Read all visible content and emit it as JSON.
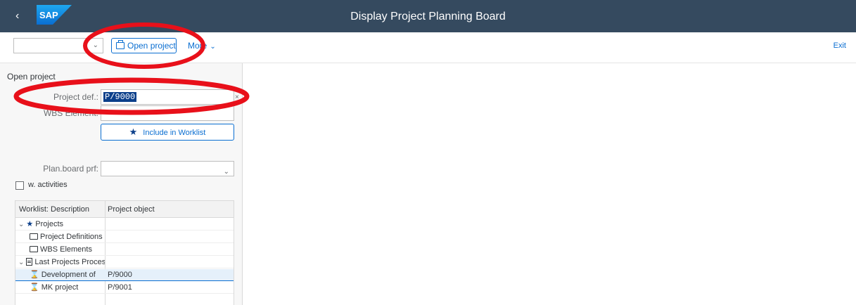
{
  "shell": {
    "back_glyph": "‹",
    "logo_text": "SAP",
    "title": "Display Project Planning Board",
    "brand_color": "#354a5f"
  },
  "toolbar": {
    "combo_value": "",
    "open_project_label": "Open project",
    "more_label": "More",
    "exit_label": "Exit"
  },
  "panel": {
    "group_title": "Open project",
    "project_def_label": "Project def.:",
    "project_def_value": "P/9000",
    "wbs_label": "WBS Element:",
    "wbs_value": "",
    "include_worklist_label": "Include in Worklist",
    "plan_board_label": "Plan.board prf:",
    "plan_board_value": "",
    "activities_label": "w. activities",
    "activities_checked": false
  },
  "worklist": {
    "columns": [
      "Worklist: Description",
      "Project object"
    ],
    "rows": [
      {
        "description": "Projects",
        "object": "",
        "icon": "star-icon",
        "toggle": "expanded"
      },
      {
        "description": "Project Definitions",
        "object": "",
        "icon": "folder-icon"
      },
      {
        "description": "WBS Elements",
        "object": "",
        "icon": "folder-icon"
      },
      {
        "description": "Last Projects Processed",
        "object": "",
        "icon": "document-icon",
        "toggle": "expanded"
      },
      {
        "description": "Development of",
        "object": "P/9000",
        "icon": "project-icon",
        "selected": true
      },
      {
        "description": "MK project",
        "object": "P/9001",
        "icon": "project-icon"
      }
    ]
  },
  "colors": {
    "accent": "#0a6ed1",
    "annotation": "#e8101a",
    "selection": "#0b3f8a"
  }
}
